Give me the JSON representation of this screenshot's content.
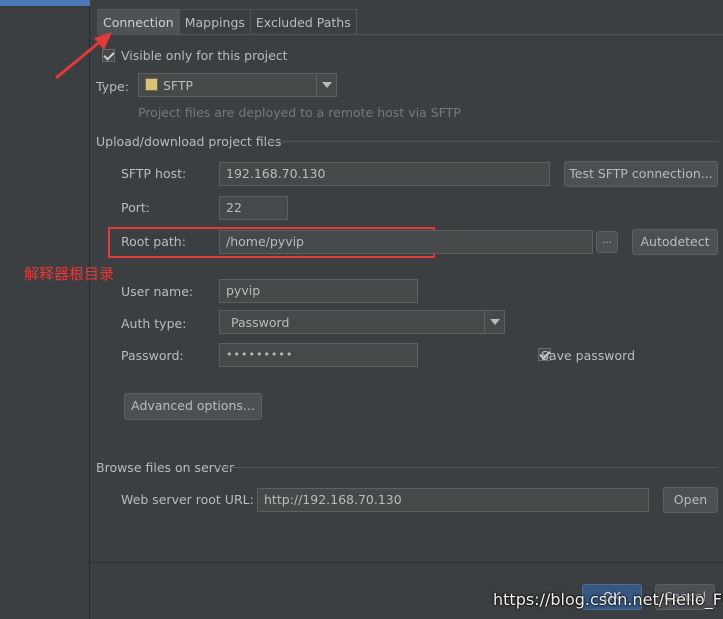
{
  "tabs": [
    {
      "label": "Connection"
    },
    {
      "label": "Mappings"
    },
    {
      "label": "Excluded Paths"
    }
  ],
  "visible_only": {
    "label": "Visible only for this project",
    "checked": true
  },
  "type": {
    "label": "Type:",
    "value": "SFTP",
    "hint": "Project files are deployed to a remote host via SFTP"
  },
  "upload_section": {
    "title": "Upload/download project files"
  },
  "sftp_host": {
    "label": "SFTP host:",
    "value": "192.168.70.130",
    "test_button": "Test SFTP connection..."
  },
  "port": {
    "label": "Port:",
    "value": "22"
  },
  "root_path": {
    "label": "Root path:",
    "value": "/home/pyvip",
    "browse_button": "...",
    "autodetect_button": "Autodetect"
  },
  "annotation": "解释器根目录",
  "user_name": {
    "label": "User name:",
    "value": "pyvip"
  },
  "auth_type": {
    "label": "Auth type:",
    "value": "Password"
  },
  "password": {
    "label": "Password:",
    "value": "•••••••••",
    "save_label": "Save password",
    "save_checked": true
  },
  "advanced_button": "Advanced options...",
  "browse_section": {
    "title": "Browse files on server"
  },
  "web_root": {
    "label": "Web server root URL:",
    "value": "http://192.168.70.130",
    "open_button": "Open"
  },
  "footer": {
    "ok": "OK",
    "cancel": "Cancel"
  },
  "watermark": "https://blog.csdn.net/Hello_Fsir",
  "colors": {
    "accent_arrow": "#e23a3a",
    "background": "#3c3f41"
  }
}
